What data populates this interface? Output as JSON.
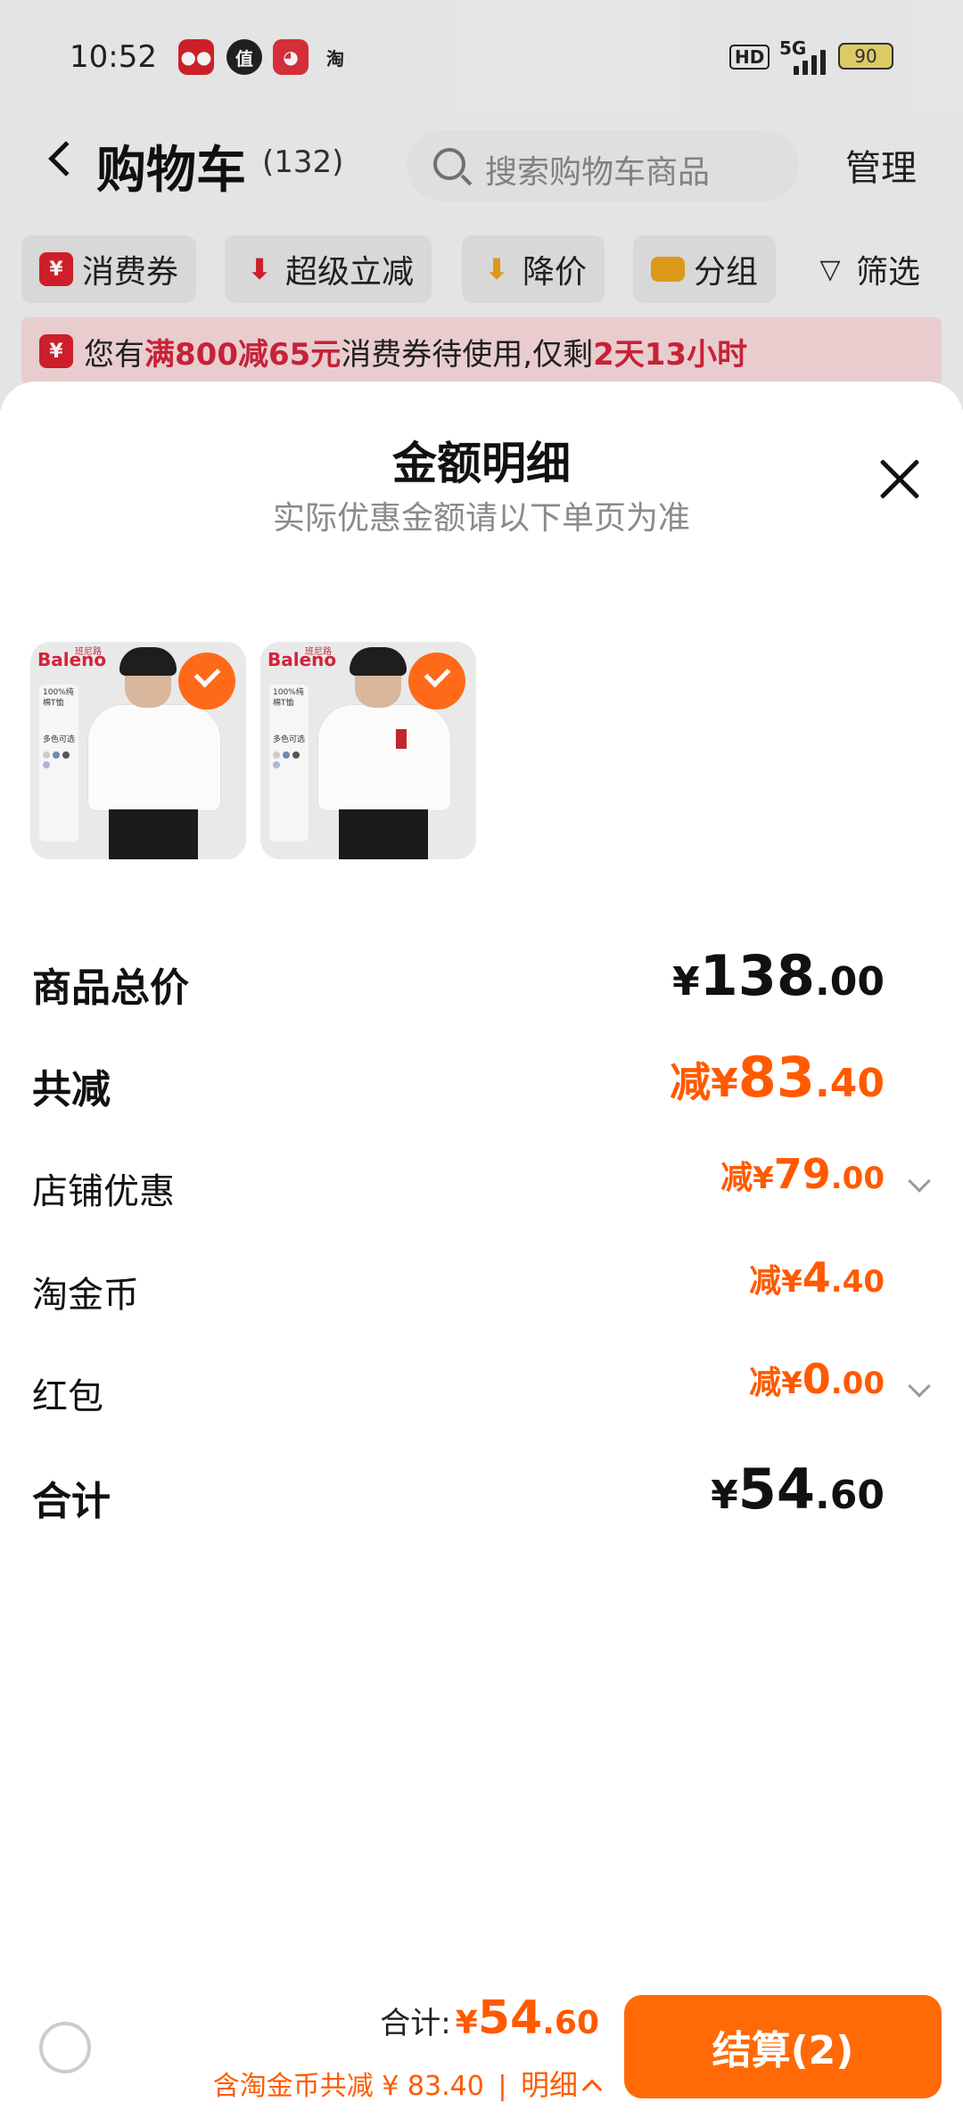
{
  "status_bar": {
    "time": "10:52",
    "notif_icons": [
      "tmall-icon",
      "zhi-icon",
      "pig-app-icon",
      "taobao-icon"
    ],
    "notif_labels": [
      "",
      "值",
      "",
      "淘"
    ],
    "hd": "HD",
    "network": "5G",
    "battery": "90"
  },
  "nav": {
    "title": "购物车",
    "count": "(132)",
    "search_placeholder": "搜索购物车商品",
    "manage": "管理"
  },
  "chips": [
    {
      "label": "消费券",
      "icon": "coupon-icon"
    },
    {
      "label": "超级立减",
      "icon": "arrow-down-icon"
    },
    {
      "label": "降价",
      "icon": "price-drop-icon"
    },
    {
      "label": "分组",
      "icon": "folder-icon"
    },
    {
      "label": "筛选",
      "icon": "filter-icon"
    }
  ],
  "banner": {
    "prefix": "您有",
    "highlight1": "满800减65元",
    "middle": "消费券待使用,仅剩",
    "highlight2": "2天13小时"
  },
  "sheet": {
    "title": "金额明细",
    "subtitle": "实际优惠金额请以下单页为准",
    "products": [
      {
        "brand": "Baleno",
        "badge": "班尼路",
        "info": "100%纯棉T恤",
        "colors": "多色可选",
        "selected": true
      },
      {
        "brand": "Baleno",
        "badge": "班尼路",
        "info": "100%纯棉T恤",
        "colors": "多色可选",
        "selected": true
      }
    ],
    "rows": {
      "subtotal": {
        "label": "商品总价",
        "yen": "¥",
        "int": "138",
        "dec": ".00"
      },
      "total_discount": {
        "label": "共减",
        "prefix": "减",
        "yen": "¥",
        "int": "83",
        "dec": ".40"
      },
      "shop_discount": {
        "label": "店铺优惠",
        "prefix": "减",
        "yen": "¥",
        "int": "79",
        "dec": ".00"
      },
      "coins": {
        "label": "淘金币",
        "prefix": "减",
        "yen": "¥",
        "int": "4",
        "dec": ".40"
      },
      "red_packet": {
        "label": "红包",
        "prefix": "减",
        "yen": "¥",
        "int": "0",
        "dec": ".00"
      },
      "total": {
        "label": "合计",
        "yen": "¥",
        "int": "54",
        "dec": ".60"
      }
    }
  },
  "bottom": {
    "total_label": "合计:",
    "yen": "¥",
    "int": "54",
    "dec": ".60",
    "saving_text": "含淘金币共减 ¥ 83.40",
    "separator": "|",
    "detail": "明细",
    "checkout": "结算(2)"
  },
  "colors": {
    "accent": "#ff6a07",
    "discount": "#ff5a00",
    "banner_highlight": "#d1243b"
  }
}
